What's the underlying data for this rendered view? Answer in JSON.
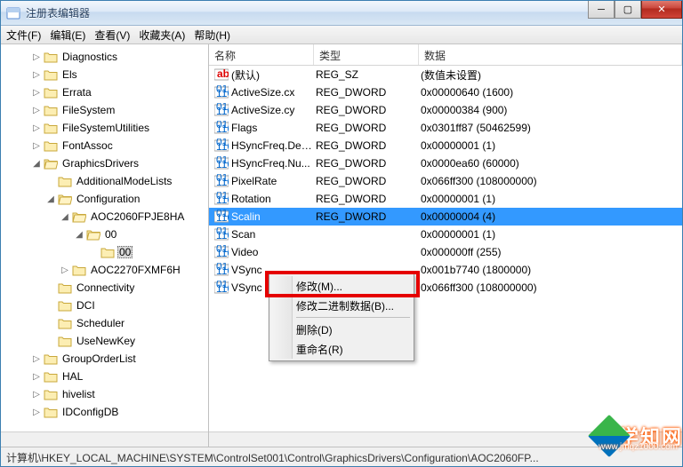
{
  "window": {
    "title": "注册表编辑器"
  },
  "menubar": {
    "file": "文件(F)",
    "edit": "编辑(E)",
    "view": "查看(V)",
    "favorites": "收藏夹(A)",
    "help": "帮助(H)"
  },
  "tree": [
    {
      "indent": 2,
      "tw": "▷",
      "label": "Diagnostics"
    },
    {
      "indent": 2,
      "tw": "▷",
      "label": "Els"
    },
    {
      "indent": 2,
      "tw": "▷",
      "label": "Errata"
    },
    {
      "indent": 2,
      "tw": "▷",
      "label": "FileSystem"
    },
    {
      "indent": 2,
      "tw": "▷",
      "label": "FileSystemUtilities"
    },
    {
      "indent": 2,
      "tw": "▷",
      "label": "FontAssoc"
    },
    {
      "indent": 2,
      "tw": "◢",
      "label": "GraphicsDrivers"
    },
    {
      "indent": 3,
      "tw": "",
      "label": "AdditionalModeLists"
    },
    {
      "indent": 3,
      "tw": "◢",
      "label": "Configuration"
    },
    {
      "indent": 4,
      "tw": "◢",
      "label": "AOC2060FPJE8HA"
    },
    {
      "indent": 5,
      "tw": "◢",
      "label": "00"
    },
    {
      "indent": 6,
      "tw": "",
      "label": "00",
      "sel": true
    },
    {
      "indent": 4,
      "tw": "▷",
      "label": "AOC2270FXMF6H"
    },
    {
      "indent": 3,
      "tw": "",
      "label": "Connectivity"
    },
    {
      "indent": 3,
      "tw": "",
      "label": "DCI"
    },
    {
      "indent": 3,
      "tw": "",
      "label": "Scheduler"
    },
    {
      "indent": 3,
      "tw": "",
      "label": "UseNewKey"
    },
    {
      "indent": 2,
      "tw": "▷",
      "label": "GroupOrderList"
    },
    {
      "indent": 2,
      "tw": "▷",
      "label": "HAL"
    },
    {
      "indent": 2,
      "tw": "▷",
      "label": "hivelist"
    },
    {
      "indent": 2,
      "tw": "▷",
      "label": "IDConfigDB"
    }
  ],
  "list": {
    "cols": {
      "name": "名称",
      "type": "类型",
      "data": "数据"
    },
    "rows": [
      {
        "icon": "sz",
        "name": "(默认)",
        "type": "REG_SZ",
        "data": "(数值未设置)"
      },
      {
        "icon": "dw",
        "name": "ActiveSize.cx",
        "type": "REG_DWORD",
        "data": "0x00000640 (1600)"
      },
      {
        "icon": "dw",
        "name": "ActiveSize.cy",
        "type": "REG_DWORD",
        "data": "0x00000384 (900)"
      },
      {
        "icon": "dw",
        "name": "Flags",
        "type": "REG_DWORD",
        "data": "0x0301ff87 (50462599)"
      },
      {
        "icon": "dw",
        "name": "HSyncFreq.Den...",
        "type": "REG_DWORD",
        "data": "0x00000001 (1)"
      },
      {
        "icon": "dw",
        "name": "HSyncFreq.Nu...",
        "type": "REG_DWORD",
        "data": "0x0000ea60 (60000)"
      },
      {
        "icon": "dw",
        "name": "PixelRate",
        "type": "REG_DWORD",
        "data": "0x066ff300 (108000000)"
      },
      {
        "icon": "dw",
        "name": "Rotation",
        "type": "REG_DWORD",
        "data": "0x00000001 (1)"
      },
      {
        "icon": "dw",
        "name": "Scalin",
        "type": "REG_DWORD",
        "data": "0x00000004 (4)",
        "selected": true
      },
      {
        "icon": "dw",
        "name": "Scan",
        "type": "",
        "data": "0x00000001 (1)"
      },
      {
        "icon": "dw",
        "name": "Video",
        "type": "",
        "data": "0x000000ff (255)"
      },
      {
        "icon": "dw",
        "name": "VSync",
        "type": "",
        "data": "0x001b7740 (1800000)"
      },
      {
        "icon": "dw",
        "name": "VSync",
        "type": "",
        "data": "0x066ff300 (108000000)"
      }
    ]
  },
  "contextmenu": {
    "modify": "修改(M)...",
    "modify_binary": "修改二进制数据(B)...",
    "delete": "删除(D)",
    "rename": "重命名(R)"
  },
  "statusbar": {
    "path": "计算机\\HKEY_LOCAL_MACHINE\\SYSTEM\\ControlSet001\\Control\\GraphicsDrivers\\Configuration\\AOC2060FP..."
  },
  "watermark": {
    "text": "学知网",
    "url": "www.jmqz1000.com"
  }
}
